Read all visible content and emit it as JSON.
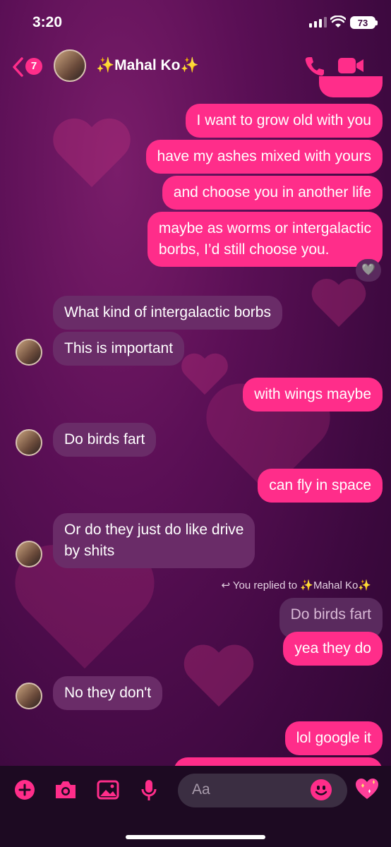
{
  "status": {
    "time": "3:20",
    "battery": "73"
  },
  "header": {
    "unread_count": "7",
    "contact_name": "✨Mahal Ko✨"
  },
  "messages": {
    "m0": "I want to grow old with you",
    "m1": "have my ashes mixed with yours",
    "m2": "and choose you in another life",
    "m3_line1": "maybe as worms or intergalactic",
    "m3_line2": "borbs, I’d still choose you.",
    "reaction": "🩶",
    "m4": "What kind of intergalactic borbs",
    "m5": "This is important",
    "m6": "with wings maybe",
    "m7": "Do birds fart",
    "m8": "can fly in space",
    "m9_line1": "Or do they just do like drive",
    "m9_line2": "by shits",
    "reply_note": "You replied to ✨Mahal Ko✨",
    "quoted": "Do birds fart",
    "m10": "yea they do",
    "m11": "No they don't",
    "m12": "lol google it"
  },
  "composer": {
    "placeholder": "Aa"
  },
  "colors": {
    "accent": "#ff2d8a",
    "incoming": "#6a2c68",
    "background": "#4a0b48"
  },
  "icons": [
    "back-chevron-icon",
    "phone-icon",
    "video-icon",
    "plus-icon",
    "camera-icon",
    "gallery-icon",
    "microphone-icon",
    "emoji-icon",
    "sparkling-heart-icon"
  ]
}
